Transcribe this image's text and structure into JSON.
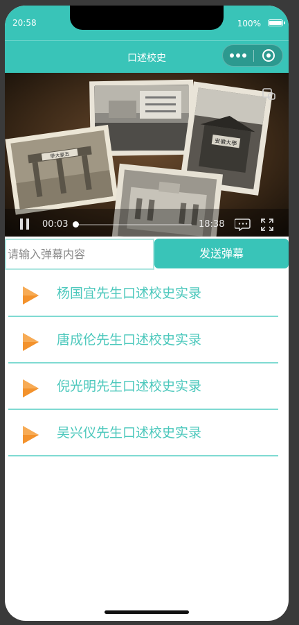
{
  "status": {
    "time": "20:58",
    "battery": "100%"
  },
  "nav": {
    "title": "口述校史"
  },
  "video": {
    "current_time": "00:03",
    "duration": "18:38",
    "progress": 0.003,
    "photo_texts": {
      "gate": "學大豪五",
      "hall": "安徽大學"
    }
  },
  "danmu": {
    "placeholder": "请输入弹幕内容",
    "send_label": "发送弹幕"
  },
  "list": [
    {
      "title": "杨国宜先生口述校史实录"
    },
    {
      "title": "唐成伦先生口述校史实录"
    },
    {
      "title": "倪光明先生口述校史实录"
    },
    {
      "title": "吴兴仪先生口述校史实录"
    }
  ],
  "colors": {
    "accent": "#39c4b8",
    "divider": "#7fdad2",
    "play": "#f3922c"
  }
}
